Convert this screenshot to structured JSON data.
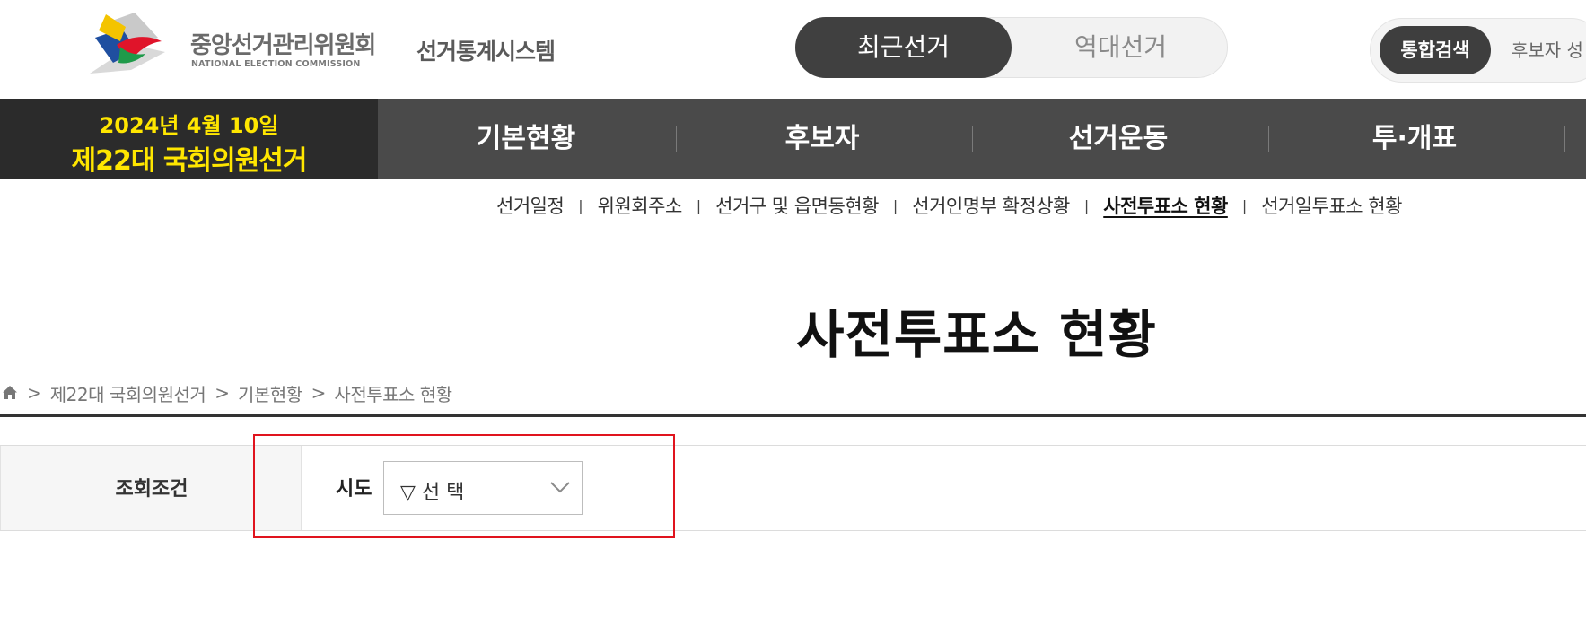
{
  "header": {
    "org_name_kr": "중앙선거관리위원회",
    "org_name_en": "NATIONAL ELECTION COMMISSION",
    "system_title": "선거통계시스템",
    "election_toggle": {
      "active": "최근선거",
      "inactive": "역대선거"
    },
    "search_tabs": {
      "active": "통합검색",
      "next": "후보자 성"
    }
  },
  "election": {
    "date": "2024년 4월 10일",
    "name": "제22대 국회의원선거"
  },
  "main_nav": {
    "items": [
      "기본현황",
      "후보자",
      "선거운동",
      "투·개표"
    ]
  },
  "sub_nav": {
    "items": [
      "선거일정",
      "위원회주소",
      "선거구 및 읍면동현황",
      "선거인명부 확정상황",
      "사전투표소 현황",
      "선거일투표소 현황"
    ],
    "current_index": 4
  },
  "page": {
    "title": "사전투표소 현황",
    "breadcrumb": [
      "제22대 국회의원선거",
      "기본현황",
      "사전투표소 현황"
    ],
    "breadcrumb_separator": ">"
  },
  "search_condition": {
    "label": "조회조건",
    "sido_label": "시도",
    "sido_selected": "▽ 선 택"
  },
  "colors": {
    "nav_bg": "#4a4a4a",
    "badge_bg": "#2b2b2b",
    "badge_text": "#ffe600",
    "highlight": "#e0141e"
  },
  "icons": [
    "logo-mark",
    "home-icon",
    "chevron-down-icon"
  ]
}
